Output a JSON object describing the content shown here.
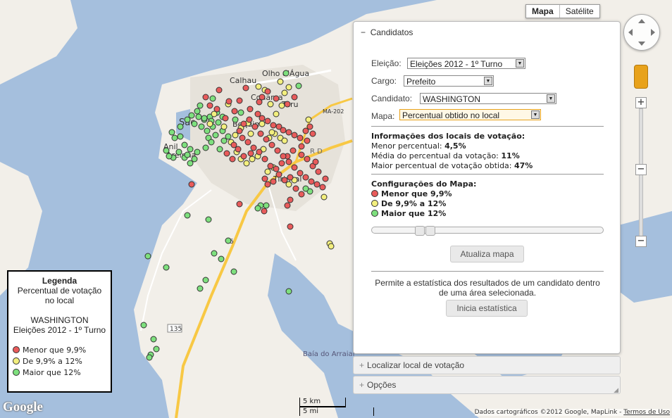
{
  "map": {
    "type_buttons": [
      "Mapa",
      "Satélite"
    ],
    "colors": {
      "water": "#a5bfdd",
      "land": "#f2efe9",
      "road_major": "#f8c844",
      "road": "#ffffff"
    },
    "labels": [
      "Olho d'Água",
      "Calhau",
      "Cohama",
      "Turu",
      "MA-202",
      "São",
      "Bequim",
      "Anil",
      "Areinha",
      "Tirirical",
      "R D",
      "Baía do Arraial",
      "135",
      "5"
    ],
    "points": {
      "red": [
        [
          311,
          128
        ],
        [
          349,
          125
        ],
        [
          325,
          144
        ],
        [
          333,
          158
        ],
        [
          340,
          143
        ],
        [
          355,
          155
        ],
        [
          368,
          145
        ],
        [
          372,
          138
        ],
        [
          380,
          130
        ],
        [
          392,
          140
        ],
        [
          408,
          148
        ],
        [
          418,
          138
        ],
        [
          366,
          162
        ],
        [
          372,
          168
        ],
        [
          380,
          172
        ],
        [
          388,
          178
        ],
        [
          396,
          180
        ],
        [
          402,
          185
        ],
        [
          410,
          188
        ],
        [
          418,
          192
        ],
        [
          426,
          196
        ],
        [
          434,
          186
        ],
        [
          440,
          180
        ],
        [
          444,
          190
        ],
        [
          436,
          200
        ],
        [
          428,
          208
        ],
        [
          416,
          214
        ],
        [
          408,
          222
        ],
        [
          400,
          232
        ],
        [
          392,
          240
        ],
        [
          384,
          236
        ],
        [
          376,
          226
        ],
        [
          368,
          216
        ],
        [
          360,
          210
        ],
        [
          352,
          202
        ],
        [
          344,
          196
        ],
        [
          340,
          186
        ],
        [
          346,
          176
        ],
        [
          354,
          170
        ],
        [
          362,
          180
        ],
        [
          370,
          190
        ],
        [
          378,
          198
        ],
        [
          386,
          206
        ],
        [
          394,
          214
        ],
        [
          402,
          222
        ],
        [
          410,
          230
        ],
        [
          418,
          238
        ],
        [
          426,
          246
        ],
        [
          434,
          252
        ],
        [
          442,
          258
        ],
        [
          450,
          262
        ],
        [
          458,
          266
        ],
        [
          462,
          254
        ],
        [
          452,
          244
        ],
        [
          444,
          236
        ],
        [
          436,
          226
        ],
        [
          428,
          220
        ],
        [
          412,
          252
        ],
        [
          420,
          268
        ],
        [
          428,
          276
        ],
        [
          412,
          284
        ],
        [
          408,
          292
        ],
        [
          404,
          256
        ],
        [
          396,
          248
        ],
        [
          388,
          258
        ],
        [
          380,
          262
        ],
        [
          376,
          254
        ],
        [
          272,
          262
        ],
        [
          292,
          138
        ],
        [
          298,
          150
        ],
        [
          308,
          155
        ],
        [
          320,
          168
        ],
        [
          338,
          212
        ],
        [
          346,
          222
        ],
        [
          330,
          226
        ],
        [
          322,
          218
        ],
        [
          332,
          206
        ],
        [
          412,
          322
        ],
        [
          448,
          230
        ],
        [
          340,
          290
        ],
        [
          375,
          300
        ],
        [
          356,
          218
        ]
      ],
      "yellow": [
        [
          367,
          123
        ],
        [
          376,
          128
        ],
        [
          398,
          116
        ],
        [
          404,
          132
        ],
        [
          410,
          124
        ],
        [
          400,
          150
        ],
        [
          392,
          162
        ],
        [
          384,
          148
        ],
        [
          352,
          175
        ],
        [
          342,
          182
        ],
        [
          334,
          192
        ],
        [
          328,
          202
        ],
        [
          336,
          216
        ],
        [
          342,
          226
        ],
        [
          350,
          232
        ],
        [
          358,
          226
        ],
        [
          366,
          222
        ],
        [
          374,
          212
        ],
        [
          382,
          196
        ],
        [
          390,
          190
        ],
        [
          398,
          196
        ],
        [
          386,
          188
        ],
        [
          380,
          244
        ],
        [
          388,
          238
        ],
        [
          410,
          262
        ],
        [
          418,
          256
        ],
        [
          460,
          280
        ],
        [
          468,
          346
        ],
        [
          470,
          350
        ],
        [
          304,
          162
        ],
        [
          298,
          176
        ],
        [
          318,
          180
        ],
        [
          324,
          148
        ],
        [
          438,
          170
        ],
        [
          372,
          176
        ],
        [
          356,
          190
        ],
        [
          404,
          200
        ]
      ],
      "green": [
        [
          424,
          122
        ],
        [
          406,
          104
        ],
        [
          302,
          140
        ],
        [
          284,
          150
        ],
        [
          280,
          158
        ],
        [
          272,
          164
        ],
        [
          266,
          170
        ],
        [
          276,
          176
        ],
        [
          286,
          180
        ],
        [
          294,
          186
        ],
        [
          302,
          180
        ],
        [
          310,
          174
        ],
        [
          316,
          166
        ],
        [
          308,
          160
        ],
        [
          298,
          166
        ],
        [
          290,
          170
        ],
        [
          282,
          166
        ],
        [
          296,
          196
        ],
        [
          306,
          192
        ],
        [
          300,
          202
        ],
        [
          292,
          210
        ],
        [
          280,
          216
        ],
        [
          270,
          212
        ],
        [
          262,
          206
        ],
        [
          254,
          216
        ],
        [
          246,
          224
        ],
        [
          240,
          222
        ],
        [
          236,
          214
        ],
        [
          248,
          196
        ],
        [
          244,
          188
        ],
        [
          256,
          180
        ],
        [
          262,
          224
        ],
        [
          270,
          232
        ],
        [
          276,
          226
        ],
        [
          266,
          220
        ],
        [
          290,
          168
        ],
        [
          300,
          172
        ],
        [
          316,
          186
        ],
        [
          324,
          194
        ],
        [
          318,
          200
        ],
        [
          312,
          212
        ],
        [
          256,
          194
        ],
        [
          266,
          306
        ],
        [
          296,
          312
        ],
        [
          304,
          360
        ],
        [
          324,
          342
        ],
        [
          314,
          368
        ],
        [
          332,
          386
        ],
        [
          292,
          398
        ],
        [
          284,
          410
        ],
        [
          236,
          380
        ],
        [
          210,
          364
        ],
        [
          204,
          462
        ],
        [
          218,
          482
        ],
        [
          222,
          496
        ],
        [
          214,
          504
        ],
        [
          212,
          508
        ],
        [
          410,
          414
        ],
        [
          440,
          272
        ],
        [
          434,
          268
        ],
        [
          370,
          292
        ],
        [
          366,
          296
        ],
        [
          378,
          292
        ],
        [
          342,
          160
        ],
        [
          334,
          170
        ]
      ]
    }
  },
  "panel": {
    "title": "Candidatos",
    "eleicao_label": "Eleição:",
    "eleicao_value": "Eleições 2012 - 1º Turno",
    "cargo_label": "Cargo:",
    "cargo_value": "Prefeito",
    "candidato_label": "Candidato:",
    "candidato_value": "WASHINGTON",
    "mapa_label": "Mapa:",
    "mapa_value": "Percentual obtido no local",
    "info_title": "Informações dos locais de votação:",
    "menor_label": "Menor percentual:",
    "menor_value": "4,5%",
    "media_label": "Média do percentual da votação:",
    "media_value": "11%",
    "maior_label": "Maior percentual de votação obtida:",
    "maior_value": "47%",
    "config_title": "Configurações do Mapa:",
    "config_items": [
      "Menor que 9,9%",
      "De 9,9% a 12%",
      "Maior que 12%"
    ],
    "atualiza_button": "Atualiza mapa",
    "description": "Permite a estatística dos resultados de um candidato dentro de uma área selecionada.",
    "inicia_button": "Inicia estatística",
    "collapsed_sections": [
      "Localizar local de votação",
      "Opções"
    ]
  },
  "legend": {
    "title": "Legenda",
    "subtitle_1": "Percentual de votação",
    "subtitle_2": "no local",
    "candidate": "WASHINGTON",
    "election": "Eleições 2012 - 1º Turno",
    "items": [
      "Menor que 9,9%",
      "De 9,9% a 12%",
      "Maior que 12%"
    ]
  },
  "colors": {
    "red": "#e85b5b",
    "yellow": "#f3ef7e",
    "green": "#7ee07e"
  },
  "footer": {
    "logo": "Google",
    "scale_km": "5 km",
    "scale_mi": "5 mi",
    "copyright": "Dados cartográficos ©2012 Google, MapLink - ",
    "terms": "Termos de Uso"
  }
}
